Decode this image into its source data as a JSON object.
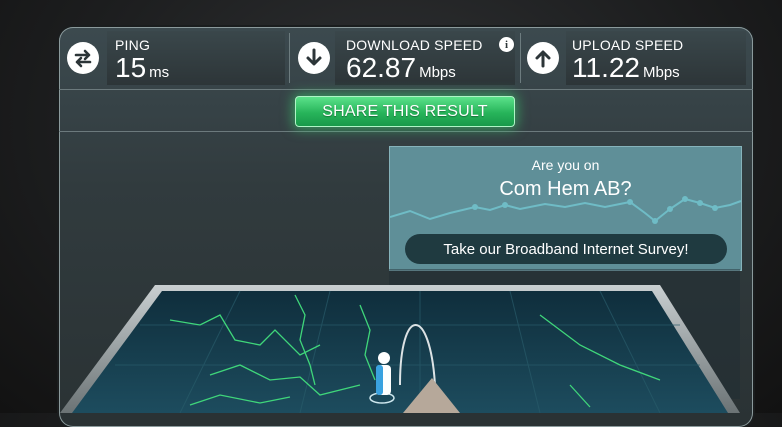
{
  "metrics": {
    "ping": {
      "label": "PING",
      "value": "15",
      "unit": "ms",
      "icon": "swap-arrows-icon"
    },
    "download": {
      "label": "DOWNLOAD SPEED",
      "value": "62.87",
      "unit": "Mbps",
      "icon": "arrow-down-icon",
      "info_icon": "info-icon"
    },
    "upload": {
      "label": "UPLOAD SPEED",
      "value": "11.22",
      "unit": "Mbps",
      "icon": "arrow-up-icon"
    }
  },
  "share": {
    "label": "SHARE THIS RESULT"
  },
  "survey": {
    "line1": "Are you on",
    "isp": "Com Hem AB?",
    "cta": "Take our Broadband Internet Survey!"
  },
  "colors": {
    "accent_green": "#27b45a",
    "survey_bg": "#5f8f98",
    "map_line": "#3fd67a"
  }
}
